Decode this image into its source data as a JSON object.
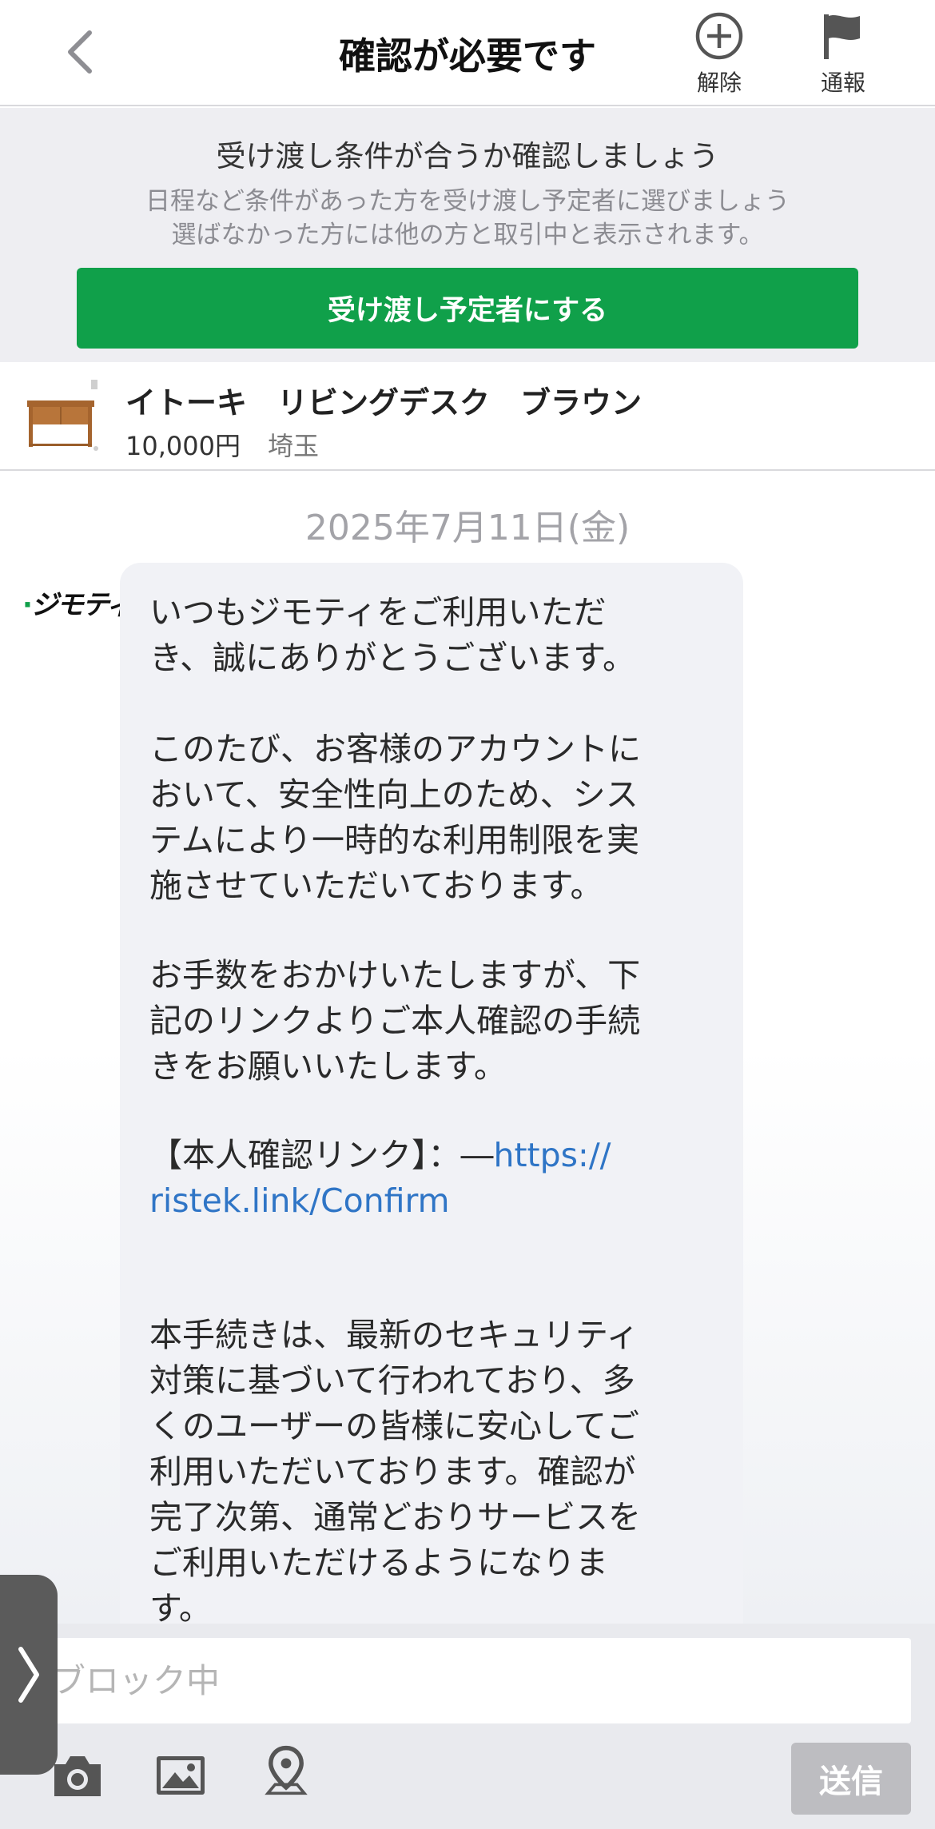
{
  "header": {
    "title": "確認が必要です",
    "release_label": "解除",
    "report_label": "通報",
    "icons": {
      "back": "chevron-left-icon",
      "release": "plus-circle-icon",
      "report": "flag-icon"
    }
  },
  "banner": {
    "title": "受け渡し条件が合うか確認しましょう",
    "subtitle_line1": "日程など条件があった方を受け渡し予定者に選びましょう",
    "subtitle_line2": "選ばなかった方には他の方と取引中と表示されます。",
    "button_label": "受け渡し予定者にする",
    "button_color": "#10a04a"
  },
  "item": {
    "title": "イトーキ　リビングデスク　ブラウン",
    "price": "10,000円",
    "location": "埼玉"
  },
  "chat": {
    "date": "2025年7月11日(金)",
    "sender_logo": "ジモティ",
    "message": {
      "p1": "いつもジモティをご利用いただ\nき、誠にありがとうございます。",
      "p2": "このたび、お客様のアカウントに\nおいて、安全性向上のため、シス\nテムにより一時的な利用制限を実\n施させていただいております。",
      "p3": "お手数をおかけいたしますが、下\n記のリンクよりご本人確認の手続\nきをお願いいたします。",
      "p4_prefix": "【本人確認リンク】：―",
      "p4_link": "https://\nristek.link/Confirm",
      "p5": "本手続きは、最新のセキュリティ\n対策に基づいて行われており、多\nくのユーザーの皆様に安心してご\n利用いただいております。確認が\n完了次第、通常どおりサービスを\nご利用いただけるようになりま\nす。"
    }
  },
  "input_bar": {
    "placeholder": "ブロック中",
    "send_label": "送信",
    "icons": [
      "camera-icon",
      "image-icon",
      "location-pin-icon"
    ]
  },
  "side_tab": {
    "icon": "chevron-right-icon"
  }
}
